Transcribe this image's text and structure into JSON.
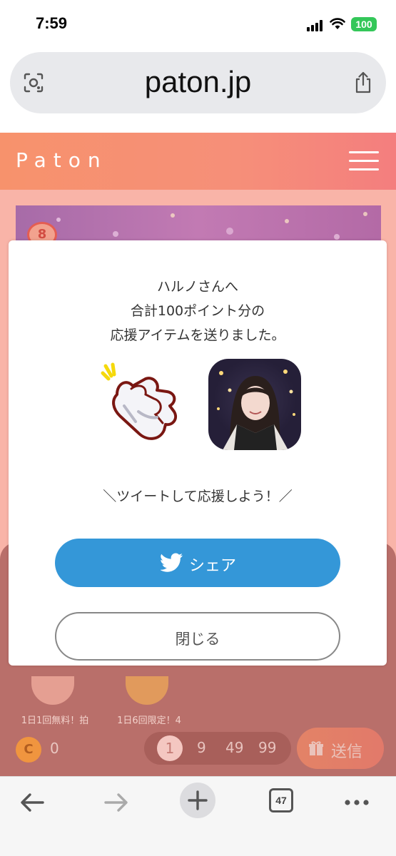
{
  "status_bar": {
    "time": "7:59",
    "battery": "100"
  },
  "browser": {
    "url": "paton.jp",
    "tab_count": "47"
  },
  "site": {
    "logo": "Paton",
    "rank_badge": "8"
  },
  "background_page": {
    "items": [
      {
        "label": "1日1回無料！拍"
      },
      {
        "label": "1日6回限定！4"
      }
    ],
    "coin_icon": "C",
    "coin_count": "0",
    "quantities": [
      "1",
      "9",
      "49",
      "99"
    ],
    "selected_quantity": "1",
    "send_label": "送信"
  },
  "modal": {
    "message_lines": [
      "ハルノさんへ",
      "合計100ポイント分の",
      "応援アイテムを送りました。"
    ],
    "tweet_prompt": "＼ツイートして応援しよう！／",
    "share_label": "シェア",
    "close_label": "閉じる"
  },
  "colors": {
    "header_gradient_start": "#f7926c",
    "header_gradient_end": "#f47e7e",
    "share_button": "#3497d8",
    "battery": "#34c759"
  }
}
